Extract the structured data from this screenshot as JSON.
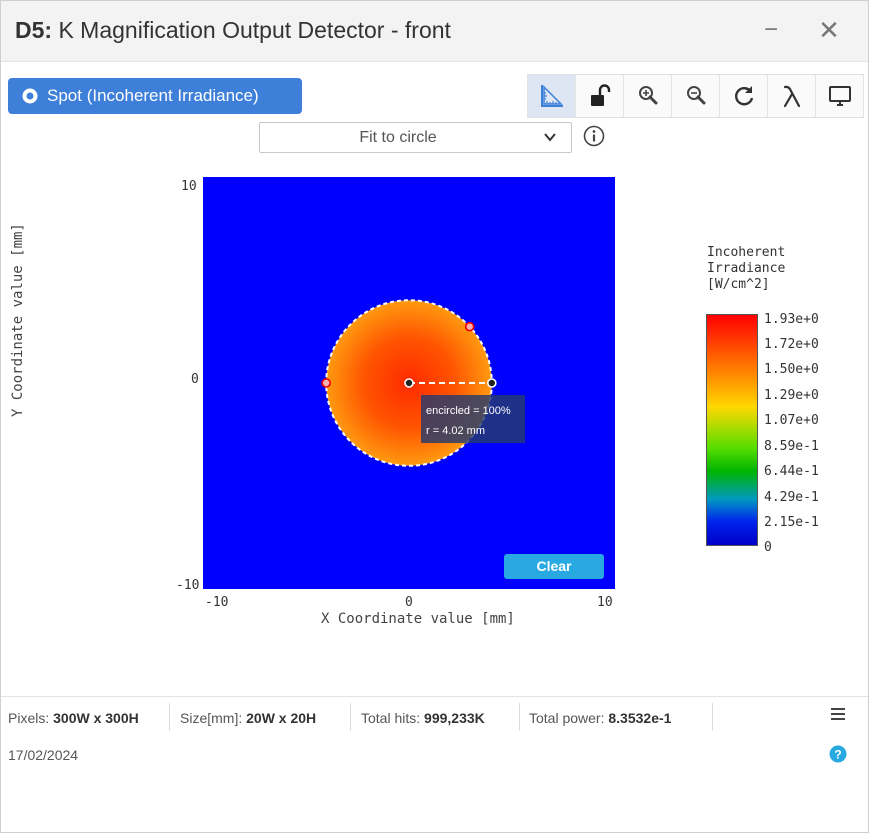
{
  "window": {
    "title_prefix": "D5:",
    "title": "K Magnification Output Detector - front",
    "minimize_glyph": "−",
    "close_glyph": "✕"
  },
  "analysis": {
    "button_label": "Spot (Incoherent Irradiance)",
    "fit_mode": "Fit to circle",
    "fit_options_visible": [
      "Fit to circle"
    ]
  },
  "toolbar": {
    "icons": [
      "ruler-icon",
      "unlock-icon",
      "zoom-in-icon",
      "zoom-out-icon",
      "refresh-icon",
      "lambda-icon",
      "monitor-icon"
    ],
    "active": "ruler-icon"
  },
  "plot": {
    "x_axis_label": "X Coordinate value [mm]",
    "y_axis_label": "Y Coordinate value [mm]",
    "x_ticks": [
      "-10",
      "0",
      "10"
    ],
    "y_ticks": [
      "10",
      "0",
      "-10"
    ],
    "xlim": [
      -10,
      10
    ],
    "ylim": [
      -10,
      10
    ],
    "spot_center_mm": [
      0,
      0
    ],
    "spot_radius_mm": 4.02,
    "tooltip_line1": "encircled = 100%",
    "tooltip_line2": "r = 4.02 mm",
    "clear_label": "Clear",
    "background_color": "#0000ff"
  },
  "legend": {
    "title_lines": [
      "Incoherent",
      "Irradiance",
      "[W/cm^2]"
    ],
    "ticks": [
      "1.93e+0",
      "1.72e+0",
      "1.50e+0",
      "1.29e+0",
      "1.07e+0",
      "8.59e-1",
      "6.44e-1",
      "4.29e-1",
      "2.15e-1",
      "0"
    ]
  },
  "status": {
    "pixels_label": "Pixels:",
    "pixels_value": "300W x 300H",
    "size_label": "Size[mm]:",
    "size_value": "20W x 20H",
    "hits_label": "Total hits:",
    "hits_value": "999,233K",
    "power_label": "Total power:",
    "power_value": "8.3532e-1",
    "date": "17/02/2024"
  },
  "colors": {
    "accent": "#3d7fd9",
    "clear_button": "#29a9e1",
    "help": "#29a9e1"
  }
}
